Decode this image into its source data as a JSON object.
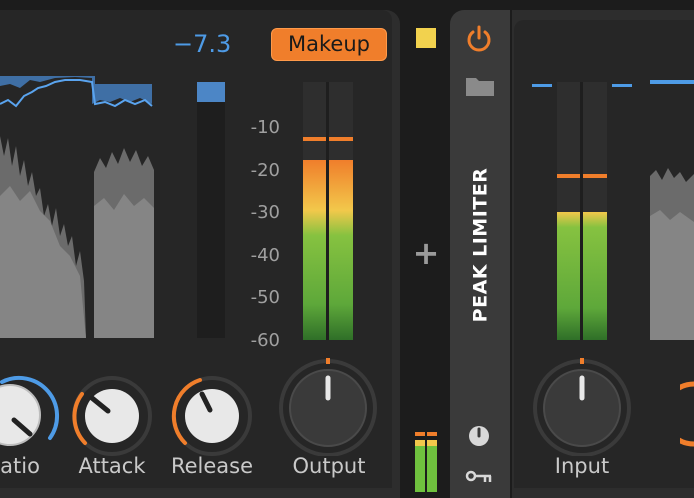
{
  "compressor": {
    "gain_readout": "−7.3",
    "makeup_label": "Makeup",
    "scale": [
      "-10",
      "-20",
      "-30",
      "-40",
      "-50",
      "-60"
    ],
    "knobs": {
      "ratio": "Ratio",
      "attack": "Attack",
      "release": "Release",
      "output": "Output"
    }
  },
  "separator": {
    "add_label": "+"
  },
  "limiter": {
    "title": "PEAK LIMITER",
    "input_label": "Input"
  },
  "colors": {
    "accent_orange": "#f07e2b",
    "accent_blue": "#4e9be6",
    "meter_green": "#6fc13e",
    "meter_yellow": "#f2c84b",
    "indicator_yellow": "#f2d24e"
  }
}
